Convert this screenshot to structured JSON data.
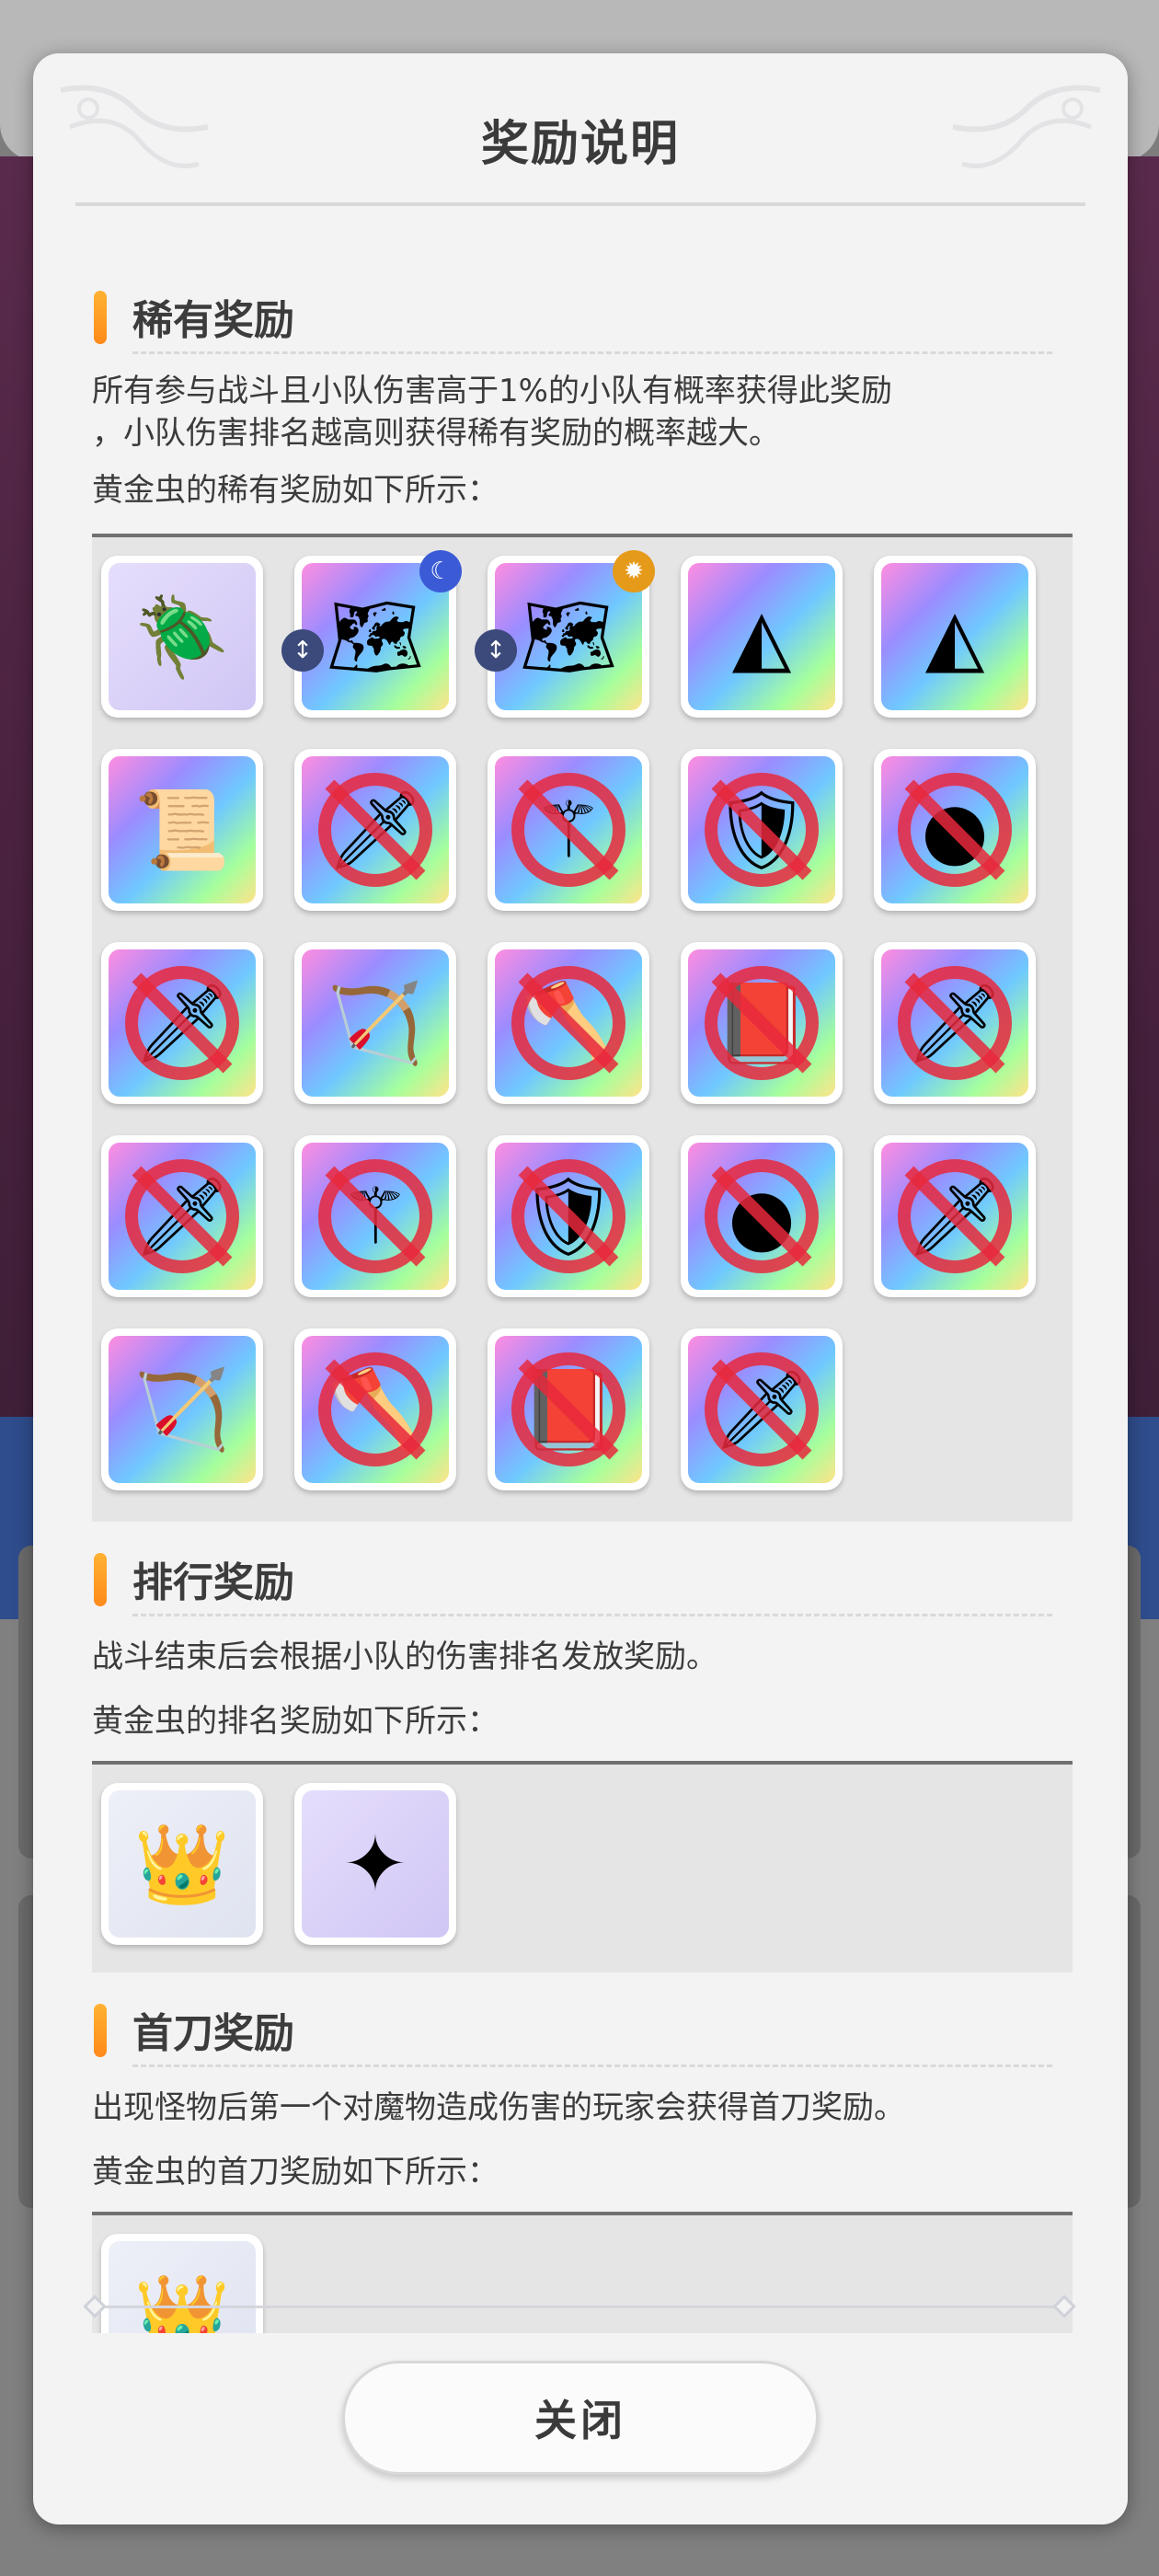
{
  "dialog": {
    "title": "奖励说明",
    "close_label": "关闭"
  },
  "sections": {
    "rare": {
      "title": "稀有奖励",
      "desc_line1": "所有参与战斗且小队伤害高于1%的小队有概率获得此奖励",
      "desc_line2": "，小队伤害排名越高则获得稀有奖励的概率越大。",
      "sub": "黄金虫的稀有奖励如下所示："
    },
    "rank": {
      "title": "排行奖励",
      "desc": "战斗结束后会根据小队的伤害排名发放奖励。",
      "sub": "黄金虫的排名奖励如下所示："
    },
    "first": {
      "title": "首刀奖励",
      "desc": "出现怪物后第一个对魔物造成伤害的玩家会获得首刀奖励。",
      "sub": "黄金虫的首刀奖励如下所示："
    }
  },
  "rare_items": [
    {
      "icon": "golden-beetle-icon",
      "glyph": "🪲",
      "bg": "lavender",
      "ban": false
    },
    {
      "icon": "beetle-card-icon",
      "glyph": "🗺",
      "bg": "rainbow",
      "ban": false,
      "badge": "blue"
    },
    {
      "icon": "beetle-card-icon",
      "glyph": "🗺",
      "bg": "rainbow",
      "ban": false,
      "badge": "gold"
    },
    {
      "icon": "prism-shard-icon",
      "glyph": "◭",
      "bg": "rainbow",
      "ban": false
    },
    {
      "icon": "prism-shard-icon",
      "glyph": "◭",
      "bg": "rainbow",
      "ban": false
    },
    {
      "icon": "treasure-map-icon",
      "glyph": "📜",
      "bg": "rainbow",
      "ban": false
    },
    {
      "icon": "sword-banned-icon",
      "glyph": "🗡",
      "bg": "rainbow",
      "ban": true
    },
    {
      "icon": "staff-banned-icon",
      "glyph": "⚚",
      "bg": "rainbow",
      "ban": true
    },
    {
      "icon": "shield-banned-icon",
      "glyph": "🛡",
      "bg": "rainbow",
      "ban": true
    },
    {
      "icon": "orb-banned-icon",
      "glyph": "●",
      "bg": "rainbow",
      "ban": true
    },
    {
      "icon": "sword-banned-icon",
      "glyph": "🗡",
      "bg": "rainbow",
      "ban": true
    },
    {
      "icon": "bow-icon",
      "glyph": "🏹",
      "bg": "rainbow",
      "ban": false
    },
    {
      "icon": "axe-banned-icon",
      "glyph": "🪓",
      "bg": "rainbow",
      "ban": true
    },
    {
      "icon": "book-banned-icon",
      "glyph": "📕",
      "bg": "rainbow",
      "ban": true
    },
    {
      "icon": "sword-banned-icon",
      "glyph": "🗡",
      "bg": "rainbow",
      "ban": true
    },
    {
      "icon": "sword-banned-icon",
      "glyph": "🗡",
      "bg": "rainbow",
      "ban": true
    },
    {
      "icon": "staff-banned-icon",
      "glyph": "⚚",
      "bg": "rainbow",
      "ban": true
    },
    {
      "icon": "shield-banned-icon",
      "glyph": "🛡",
      "bg": "rainbow",
      "ban": true
    },
    {
      "icon": "orb-banned-icon",
      "glyph": "●",
      "bg": "rainbow",
      "ban": true
    },
    {
      "icon": "sword-banned-icon",
      "glyph": "🗡",
      "bg": "rainbow",
      "ban": true
    },
    {
      "icon": "bow-icon",
      "glyph": "🏹",
      "bg": "rainbow",
      "ban": false
    },
    {
      "icon": "axe-banned-icon",
      "glyph": "🪓",
      "bg": "rainbow",
      "ban": true
    },
    {
      "icon": "book-banned-icon",
      "glyph": "📕",
      "bg": "rainbow",
      "ban": true
    },
    {
      "icon": "sword-banned-icon",
      "glyph": "🗡",
      "bg": "rainbow",
      "ban": true
    }
  ],
  "rank_items": [
    {
      "icon": "crown-coin-icon",
      "glyph": "👑",
      "bg": "gold-bg",
      "ban": false
    },
    {
      "icon": "golden-emblem-icon",
      "glyph": "✦",
      "bg": "lavender",
      "ban": false
    }
  ],
  "first_items": [
    {
      "icon": "crown-coin-icon",
      "glyph": "👑",
      "bg": "gold-bg",
      "ban": false
    }
  ],
  "colors": {
    "accent_bar": "#ff9a22",
    "ban_red": "#e8283c",
    "badge_blue": "#3b5bd6",
    "badge_gold": "#e59a1a"
  }
}
